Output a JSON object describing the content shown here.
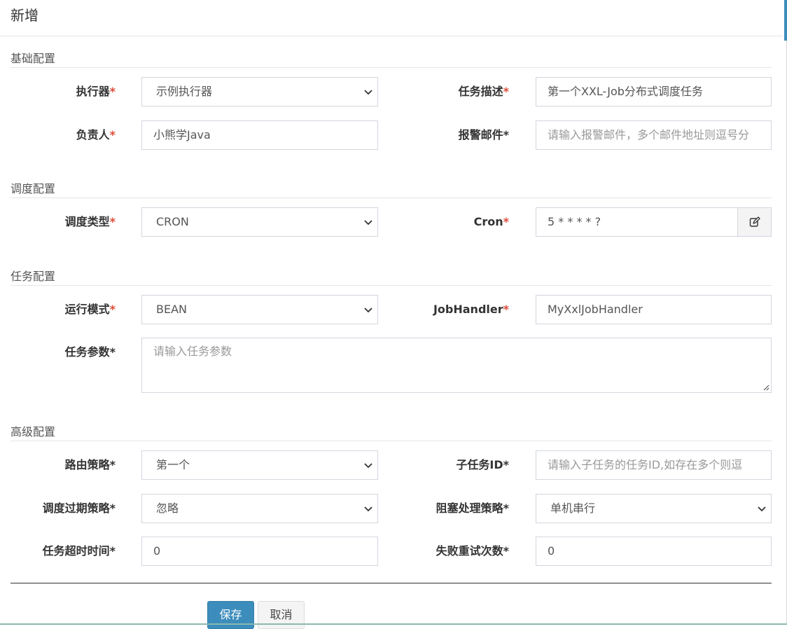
{
  "modal": {
    "title": "新增"
  },
  "sections": {
    "basic": "基础配置",
    "schedule": "调度配置",
    "task": "任务配置",
    "advanced": "高级配置"
  },
  "fields": {
    "executor": {
      "label": "执行器",
      "value": "示例执行器"
    },
    "job_desc": {
      "label": "任务描述",
      "value": "第一个XXL-Job分布式调度任务"
    },
    "owner": {
      "label": "负责人",
      "value": "小熊学Java"
    },
    "alarm_email": {
      "label": "报警邮件*",
      "placeholder": "请输入报警邮件，多个邮件地址则逗号分"
    },
    "schedule_type": {
      "label": "调度类型",
      "value": "CRON"
    },
    "cron": {
      "label": "Cron",
      "value": "5 * * * * ?"
    },
    "run_mode": {
      "label": "运行模式",
      "value": "BEAN"
    },
    "job_handler": {
      "label": "JobHandler",
      "value": "MyXxlJobHandler"
    },
    "job_param": {
      "label": "任务参数*",
      "placeholder": "请输入任务参数"
    },
    "route_strategy": {
      "label": "路由策略*",
      "value": "第一个"
    },
    "child_job_id": {
      "label": "子任务ID*",
      "placeholder": "请输入子任务的任务ID,如存在多个则逗"
    },
    "misfire_strategy": {
      "label": "调度过期策略*",
      "value": "忽略"
    },
    "block_strategy": {
      "label": "阻塞处理策略*",
      "value": "单机串行"
    },
    "timeout": {
      "label": "任务超时时间*",
      "value": "0"
    },
    "fail_retry": {
      "label": "失败重试次数*",
      "value": "0"
    }
  },
  "required_mark": "*",
  "buttons": {
    "save": "保存",
    "cancel": "取消"
  },
  "icons": {
    "cron_edit": "edit-icon",
    "select": "chevron-down-icon"
  },
  "colors": {
    "primary": "#3c8dbc",
    "required": "#dd4b39"
  }
}
